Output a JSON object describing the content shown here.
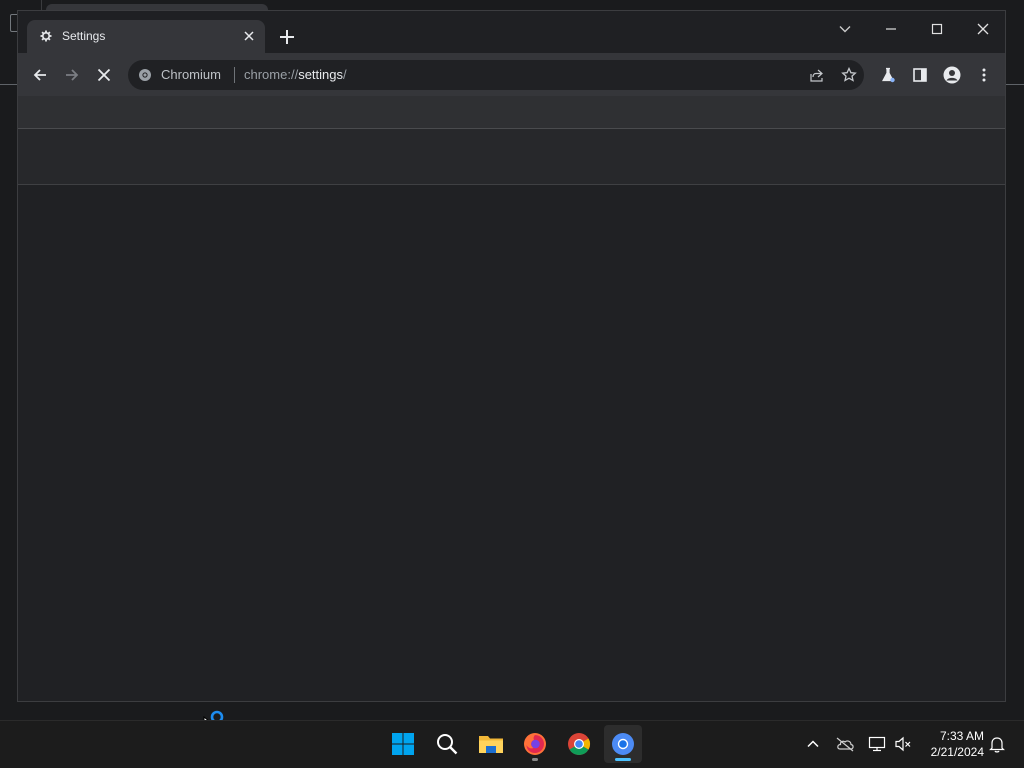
{
  "browser": {
    "tab": {
      "title": "Settings",
      "favicon": "gear-icon"
    },
    "omnibox": {
      "chip": "Chromium",
      "url_scheme": "chrome://",
      "url_host": "settings",
      "url_path": "/"
    }
  },
  "taskbar": {
    "apps": [
      "windows-start",
      "search",
      "file-explorer",
      "firefox",
      "chrome",
      "chromium"
    ],
    "clock": {
      "time": "7:33 AM",
      "date": "2/21/2024"
    }
  },
  "colors": {
    "accent": "#4cc2ff",
    "windows_blue": "#00a4ef"
  }
}
